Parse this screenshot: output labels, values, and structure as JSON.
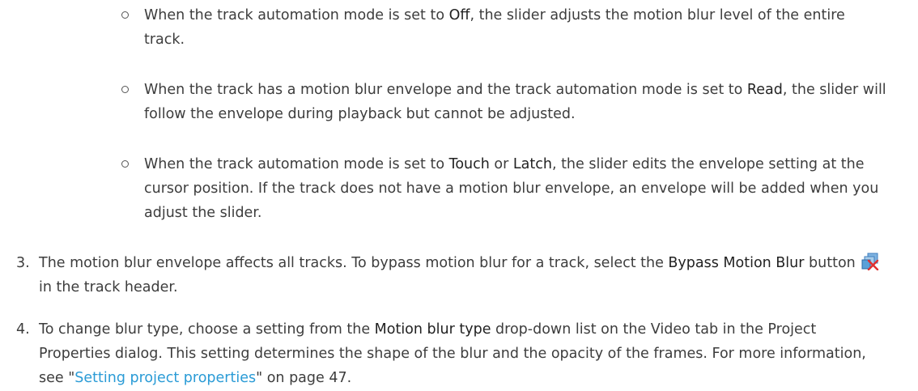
{
  "bullets": [
    {
      "pre": "When the track automation mode is set to ",
      "kw1": "Off",
      "post": ", the slider adjusts the motion blur level of the entire track."
    },
    {
      "pre": "When the track has a motion blur envelope and the track automation mode is set to ",
      "kw1": "Read",
      "post": ", the slider will follow the envelope during playback but cannot be adjusted."
    },
    {
      "pre": "When the track automation mode is set to ",
      "kw1": "Touch",
      "mid": " or ",
      "kw2": "Latch",
      "post": ", the slider edits the envelope setting at the cursor position. If the track does not have a motion blur envelope, an envelope will be added when you adjust the slider."
    }
  ],
  "steps": [
    {
      "number": "3.",
      "pre": "The motion blur envelope affects all tracks. To bypass motion blur for a track, select the ",
      "kw": "Bypass Motion Blur",
      "mid": " button ",
      "icon": "bypass-motion-blur-icon",
      "post": " in the track header."
    },
    {
      "number": "4.",
      "pre": "To change blur type, choose a setting from the ",
      "kw": "Motion blur type",
      "post": " drop-down list on the Video tab in the Project Properties dialog. This setting determines the shape of the blur and the opacity of the frames. For more information, see \"",
      "link": "Setting project properties",
      "post2": "\" on page 47."
    }
  ],
  "colors": {
    "text": "#3d3d3d",
    "link": "#2a9bd6"
  }
}
